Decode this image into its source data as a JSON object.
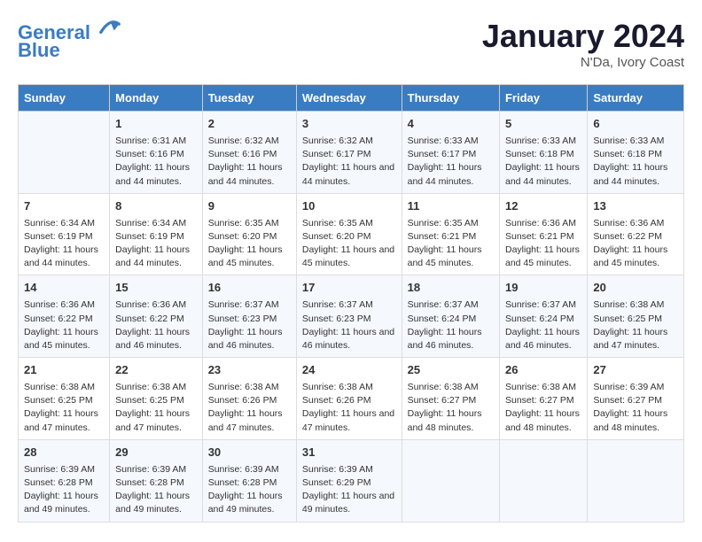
{
  "header": {
    "logo_line1": "General",
    "logo_line2": "Blue",
    "month": "January 2024",
    "location": "N'Da, Ivory Coast"
  },
  "columns": [
    "Sunday",
    "Monday",
    "Tuesday",
    "Wednesday",
    "Thursday",
    "Friday",
    "Saturday"
  ],
  "weeks": [
    [
      {
        "day": "",
        "sunrise": "",
        "sunset": "",
        "daylight": ""
      },
      {
        "day": "1",
        "sunrise": "6:31 AM",
        "sunset": "6:16 PM",
        "daylight": "11 hours and 44 minutes."
      },
      {
        "day": "2",
        "sunrise": "6:32 AM",
        "sunset": "6:16 PM",
        "daylight": "11 hours and 44 minutes."
      },
      {
        "day": "3",
        "sunrise": "6:32 AM",
        "sunset": "6:17 PM",
        "daylight": "11 hours and 44 minutes."
      },
      {
        "day": "4",
        "sunrise": "6:33 AM",
        "sunset": "6:17 PM",
        "daylight": "11 hours and 44 minutes."
      },
      {
        "day": "5",
        "sunrise": "6:33 AM",
        "sunset": "6:18 PM",
        "daylight": "11 hours and 44 minutes."
      },
      {
        "day": "6",
        "sunrise": "6:33 AM",
        "sunset": "6:18 PM",
        "daylight": "11 hours and 44 minutes."
      }
    ],
    [
      {
        "day": "7",
        "sunrise": "6:34 AM",
        "sunset": "6:19 PM",
        "daylight": "11 hours and 44 minutes."
      },
      {
        "day": "8",
        "sunrise": "6:34 AM",
        "sunset": "6:19 PM",
        "daylight": "11 hours and 44 minutes."
      },
      {
        "day": "9",
        "sunrise": "6:35 AM",
        "sunset": "6:20 PM",
        "daylight": "11 hours and 45 minutes."
      },
      {
        "day": "10",
        "sunrise": "6:35 AM",
        "sunset": "6:20 PM",
        "daylight": "11 hours and 45 minutes."
      },
      {
        "day": "11",
        "sunrise": "6:35 AM",
        "sunset": "6:21 PM",
        "daylight": "11 hours and 45 minutes."
      },
      {
        "day": "12",
        "sunrise": "6:36 AM",
        "sunset": "6:21 PM",
        "daylight": "11 hours and 45 minutes."
      },
      {
        "day": "13",
        "sunrise": "6:36 AM",
        "sunset": "6:22 PM",
        "daylight": "11 hours and 45 minutes."
      }
    ],
    [
      {
        "day": "14",
        "sunrise": "6:36 AM",
        "sunset": "6:22 PM",
        "daylight": "11 hours and 45 minutes."
      },
      {
        "day": "15",
        "sunrise": "6:36 AM",
        "sunset": "6:22 PM",
        "daylight": "11 hours and 46 minutes."
      },
      {
        "day": "16",
        "sunrise": "6:37 AM",
        "sunset": "6:23 PM",
        "daylight": "11 hours and 46 minutes."
      },
      {
        "day": "17",
        "sunrise": "6:37 AM",
        "sunset": "6:23 PM",
        "daylight": "11 hours and 46 minutes."
      },
      {
        "day": "18",
        "sunrise": "6:37 AM",
        "sunset": "6:24 PM",
        "daylight": "11 hours and 46 minutes."
      },
      {
        "day": "19",
        "sunrise": "6:37 AM",
        "sunset": "6:24 PM",
        "daylight": "11 hours and 46 minutes."
      },
      {
        "day": "20",
        "sunrise": "6:38 AM",
        "sunset": "6:25 PM",
        "daylight": "11 hours and 47 minutes."
      }
    ],
    [
      {
        "day": "21",
        "sunrise": "6:38 AM",
        "sunset": "6:25 PM",
        "daylight": "11 hours and 47 minutes."
      },
      {
        "day": "22",
        "sunrise": "6:38 AM",
        "sunset": "6:25 PM",
        "daylight": "11 hours and 47 minutes."
      },
      {
        "day": "23",
        "sunrise": "6:38 AM",
        "sunset": "6:26 PM",
        "daylight": "11 hours and 47 minutes."
      },
      {
        "day": "24",
        "sunrise": "6:38 AM",
        "sunset": "6:26 PM",
        "daylight": "11 hours and 47 minutes."
      },
      {
        "day": "25",
        "sunrise": "6:38 AM",
        "sunset": "6:27 PM",
        "daylight": "11 hours and 48 minutes."
      },
      {
        "day": "26",
        "sunrise": "6:38 AM",
        "sunset": "6:27 PM",
        "daylight": "11 hours and 48 minutes."
      },
      {
        "day": "27",
        "sunrise": "6:39 AM",
        "sunset": "6:27 PM",
        "daylight": "11 hours and 48 minutes."
      }
    ],
    [
      {
        "day": "28",
        "sunrise": "6:39 AM",
        "sunset": "6:28 PM",
        "daylight": "11 hours and 49 minutes."
      },
      {
        "day": "29",
        "sunrise": "6:39 AM",
        "sunset": "6:28 PM",
        "daylight": "11 hours and 49 minutes."
      },
      {
        "day": "30",
        "sunrise": "6:39 AM",
        "sunset": "6:28 PM",
        "daylight": "11 hours and 49 minutes."
      },
      {
        "day": "31",
        "sunrise": "6:39 AM",
        "sunset": "6:29 PM",
        "daylight": "11 hours and 49 minutes."
      },
      {
        "day": "",
        "sunrise": "",
        "sunset": "",
        "daylight": ""
      },
      {
        "day": "",
        "sunrise": "",
        "sunset": "",
        "daylight": ""
      },
      {
        "day": "",
        "sunrise": "",
        "sunset": "",
        "daylight": ""
      }
    ]
  ],
  "labels": {
    "sunrise_prefix": "Sunrise: ",
    "sunset_prefix": "Sunset: ",
    "daylight_prefix": "Daylight: "
  }
}
